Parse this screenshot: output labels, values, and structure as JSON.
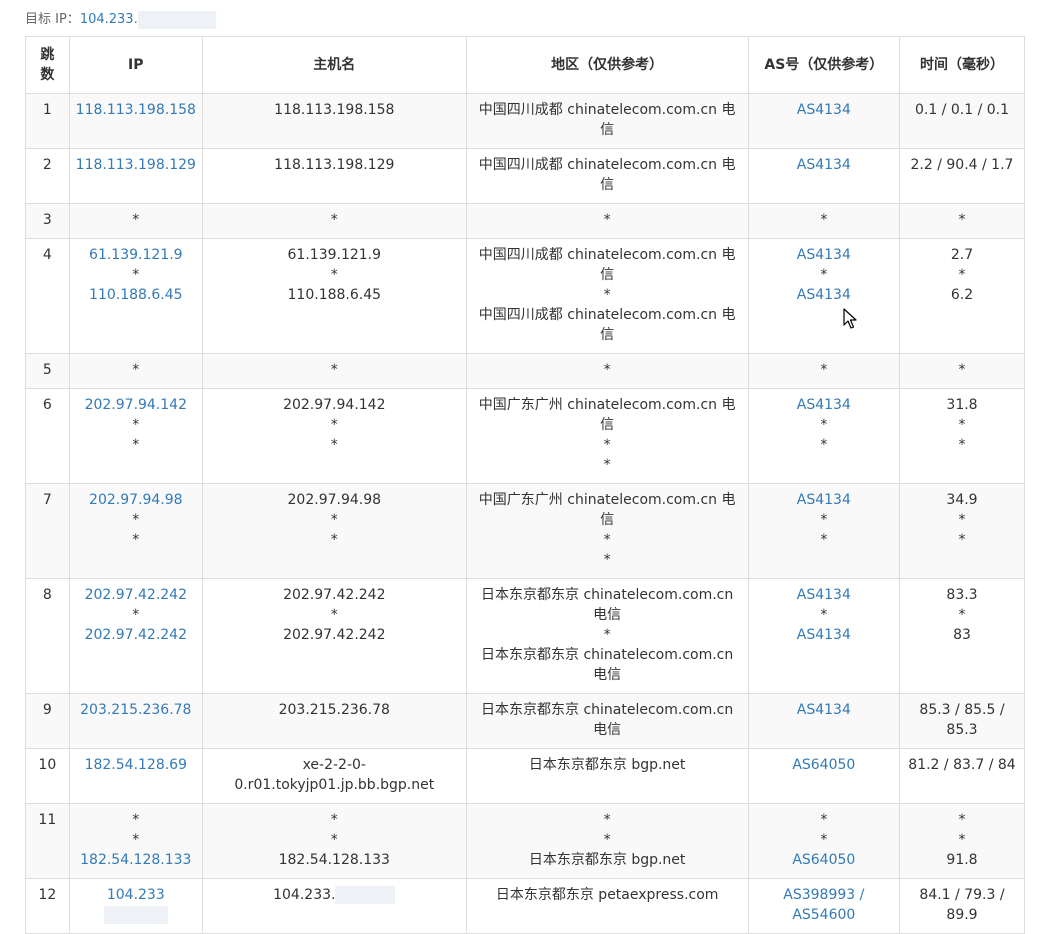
{
  "target": {
    "label": "目标 IP：",
    "ip": "104.233."
  },
  "headers": {
    "hop": "跳\n数",
    "ip": "IP",
    "host": "主机名",
    "region": "地区（仅供参考）",
    "as": "AS号（仅供参考）",
    "time": "时间（毫秒）"
  },
  "rows": [
    {
      "hop": "1",
      "ip": [
        "118.113.198.158"
      ],
      "host": [
        "118.113.198.158"
      ],
      "region": [
        "中国四川成都 chinatelecom.com.cn 电信"
      ],
      "as": [
        "AS4134"
      ],
      "time": [
        "0.1 / 0.1 / 0.1"
      ]
    },
    {
      "hop": "2",
      "ip": [
        "118.113.198.129"
      ],
      "host": [
        "118.113.198.129"
      ],
      "region": [
        "中国四川成都 chinatelecom.com.cn 电信"
      ],
      "as": [
        "AS4134"
      ],
      "time": [
        "2.2 / 90.4 / 1.7"
      ]
    },
    {
      "hop": "3",
      "ip": [
        "*"
      ],
      "host": [
        "*"
      ],
      "region": [
        "*"
      ],
      "as": [
        "*"
      ],
      "time": [
        "*"
      ]
    },
    {
      "hop": "4",
      "ip": [
        "61.139.121.9",
        "*",
        "110.188.6.45"
      ],
      "host": [
        "61.139.121.9",
        "*",
        "110.188.6.45"
      ],
      "region": [
        "中国四川成都 chinatelecom.com.cn 电信",
        "*",
        "中国四川成都 chinatelecom.com.cn 电信"
      ],
      "as": [
        "AS4134",
        "*",
        "AS4134"
      ],
      "time": [
        "2.7",
        "*",
        "6.2"
      ]
    },
    {
      "hop": "5",
      "ip": [
        "*"
      ],
      "host": [
        "*"
      ],
      "region": [
        "*"
      ],
      "as": [
        "*"
      ],
      "time": [
        "*"
      ]
    },
    {
      "hop": "6",
      "ip": [
        "202.97.94.142",
        "*",
        "*"
      ],
      "host": [
        "202.97.94.142",
        "*",
        "*"
      ],
      "region": [
        "中国广东广州 chinatelecom.com.cn 电信",
        "*",
        "*"
      ],
      "as": [
        "AS4134",
        "*",
        "*"
      ],
      "time": [
        "31.8",
        "*",
        "*"
      ]
    },
    {
      "hop": "7",
      "ip": [
        "202.97.94.98",
        "*",
        "*"
      ],
      "host": [
        "202.97.94.98",
        "*",
        "*"
      ],
      "region": [
        "中国广东广州 chinatelecom.com.cn 电信",
        "*",
        "*"
      ],
      "as": [
        "AS4134",
        "*",
        "*"
      ],
      "time": [
        "34.9",
        "*",
        "*"
      ]
    },
    {
      "hop": "8",
      "ip": [
        "202.97.42.242",
        "*",
        "202.97.42.242"
      ],
      "host": [
        "202.97.42.242",
        "*",
        "202.97.42.242"
      ],
      "region": [
        "日本东京都东京 chinatelecom.com.cn 电信",
        "*",
        "日本东京都东京 chinatelecom.com.cn 电信"
      ],
      "as": [
        "AS4134",
        "*",
        "AS4134"
      ],
      "time": [
        "83.3",
        "*",
        "83"
      ]
    },
    {
      "hop": "9",
      "ip": [
        "203.215.236.78"
      ],
      "host": [
        "203.215.236.78"
      ],
      "region": [
        "日本东京都东京 chinatelecom.com.cn 电信"
      ],
      "as": [
        "AS4134"
      ],
      "time": [
        "85.3 / 85.5 / 85.3"
      ]
    },
    {
      "hop": "10",
      "ip": [
        "182.54.128.69"
      ],
      "host": [
        "xe-2-2-0-0.r01.tokyjp01.jp.bb.bgp.net"
      ],
      "region": [
        "日本东京都东京 bgp.net"
      ],
      "as": [
        "AS64050"
      ],
      "time": [
        "81.2 / 83.7 / 84"
      ]
    },
    {
      "hop": "11",
      "ip": [
        "*",
        "*",
        "182.54.128.133"
      ],
      "host": [
        "*",
        "*",
        "182.54.128.133"
      ],
      "region": [
        "*",
        "*",
        "日本东京都东京 bgp.net"
      ],
      "as": [
        "*",
        "*",
        "AS64050"
      ],
      "time": [
        "*",
        "*",
        "91.8"
      ]
    },
    {
      "hop": "12",
      "ip": [
        "104.233"
      ],
      "host": [
        "104.233."
      ],
      "region": [
        "日本东京都东京 petaexpress.com"
      ],
      "as": [
        "AS398993 / AS54600"
      ],
      "time": [
        "84.1 / 79.3 / 89.9"
      ]
    }
  ],
  "colors": {
    "link": "#337ab7",
    "stripe": "#f9f9f9",
    "border": "#dddddd"
  }
}
